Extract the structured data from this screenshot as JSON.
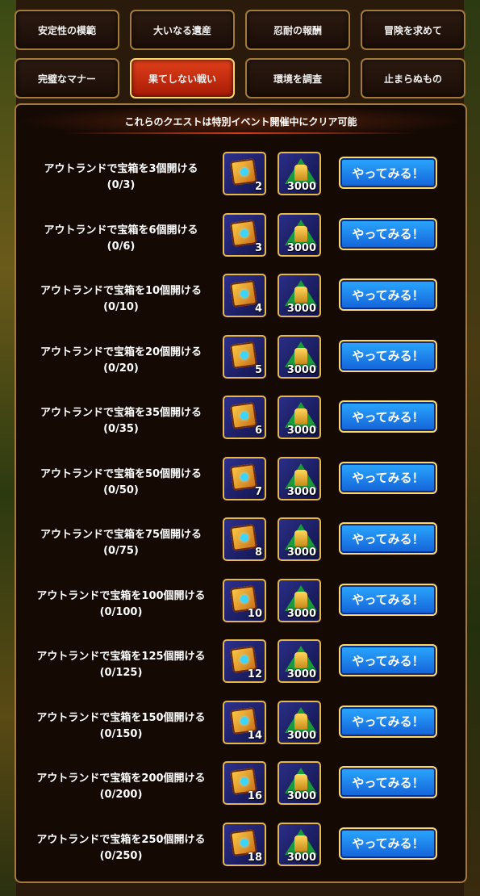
{
  "tabs": [
    {
      "label": "安定性の模範"
    },
    {
      "label": "大いなる遺産"
    },
    {
      "label": "忍耐の報酬"
    },
    {
      "label": "冒険を求めて"
    },
    {
      "label": "完璧なマナー"
    },
    {
      "label": "果てしない戦い",
      "active": true
    },
    {
      "label": "環境を調査"
    },
    {
      "label": "止まらぬもの"
    }
  ],
  "notice": "これらのクエストは特別イベント開催中にクリア可能",
  "button_label": "やってみる！",
  "quests": [
    {
      "title": "アウトランドで宝箱を3個開ける",
      "progress": "(0/3)",
      "chest_qty": "2",
      "gold_qty": "3000"
    },
    {
      "title": "アウトランドで宝箱を6個開ける",
      "progress": "(0/6)",
      "chest_qty": "3",
      "gold_qty": "3000"
    },
    {
      "title": "アウトランドで宝箱を10個開ける",
      "progress": "(0/10)",
      "chest_qty": "4",
      "gold_qty": "3000"
    },
    {
      "title": "アウトランドで宝箱を20個開ける",
      "progress": "(0/20)",
      "chest_qty": "5",
      "gold_qty": "3000"
    },
    {
      "title": "アウトランドで宝箱を35個開ける",
      "progress": "(0/35)",
      "chest_qty": "6",
      "gold_qty": "3000"
    },
    {
      "title": "アウトランドで宝箱を50個開ける",
      "progress": "(0/50)",
      "chest_qty": "7",
      "gold_qty": "3000"
    },
    {
      "title": "アウトランドで宝箱を75個開ける",
      "progress": "(0/75)",
      "chest_qty": "8",
      "gold_qty": "3000"
    },
    {
      "title": "アウトランドで宝箱を100個開ける",
      "progress": "(0/100)",
      "chest_qty": "10",
      "gold_qty": "3000"
    },
    {
      "title": "アウトランドで宝箱を125個開ける",
      "progress": "(0/125)",
      "chest_qty": "12",
      "gold_qty": "3000"
    },
    {
      "title": "アウトランドで宝箱を150個開ける",
      "progress": "(0/150)",
      "chest_qty": "14",
      "gold_qty": "3000"
    },
    {
      "title": "アウトランドで宝箱を200個開ける",
      "progress": "(0/200)",
      "chest_qty": "16",
      "gold_qty": "3000"
    },
    {
      "title": "アウトランドで宝箱を250個開ける",
      "progress": "(0/250)",
      "chest_qty": "18",
      "gold_qty": "3000"
    }
  ],
  "icons": {
    "chest": "treasure-chest-icon",
    "gold": "gold-statue-icon"
  },
  "colors": {
    "active_tab": "#c8280e",
    "button": "#1e7ef0",
    "border": "#a47a3a"
  }
}
